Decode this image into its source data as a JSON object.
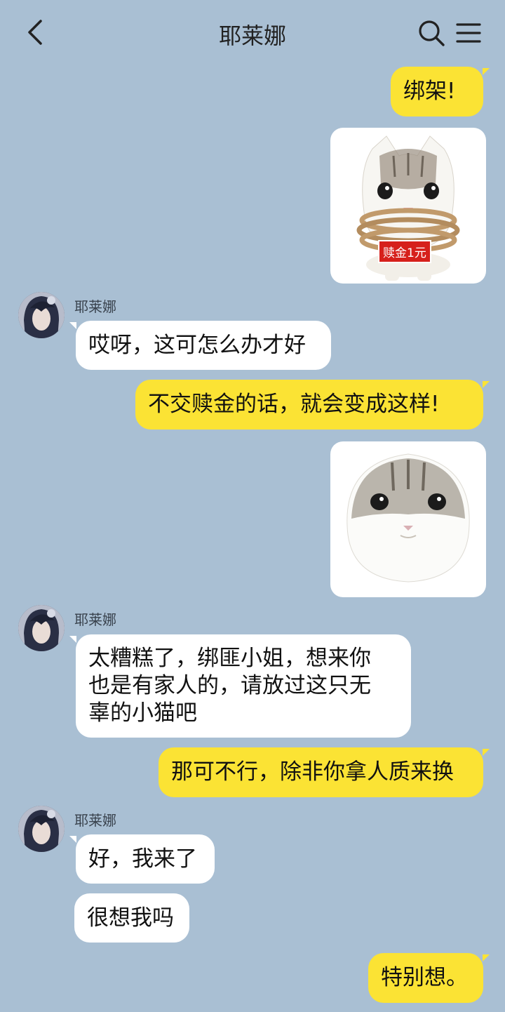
{
  "header": {
    "title": "耶莱娜"
  },
  "contact_name": "耶莱娜",
  "messages": {
    "m1": "绑架!",
    "m2": "哎呀，这可怎么办才好",
    "m3": "不交赎金的话，就会变成这样!",
    "m4_line1": "太糟糕了，绑匪小姐，想来你",
    "m4_line2": "也是有家人的，请放过这只无",
    "m4_line3": "辜的小猫吧",
    "m5": "那可不行，除非你拿人质来换",
    "m6": "好，我来了",
    "m7": "很想我吗",
    "m8": "特别想。"
  },
  "sticker1": {
    "tag": "赎金1元"
  },
  "icons": [
    "back-icon",
    "search-icon",
    "menu-icon",
    "avatar",
    "cat-sticker"
  ],
  "colors": {
    "background": "#a9bfd3",
    "my_bubble": "#fbe334",
    "their_bubble": "#ffffff",
    "ransom_tag": "#d6201b"
  }
}
